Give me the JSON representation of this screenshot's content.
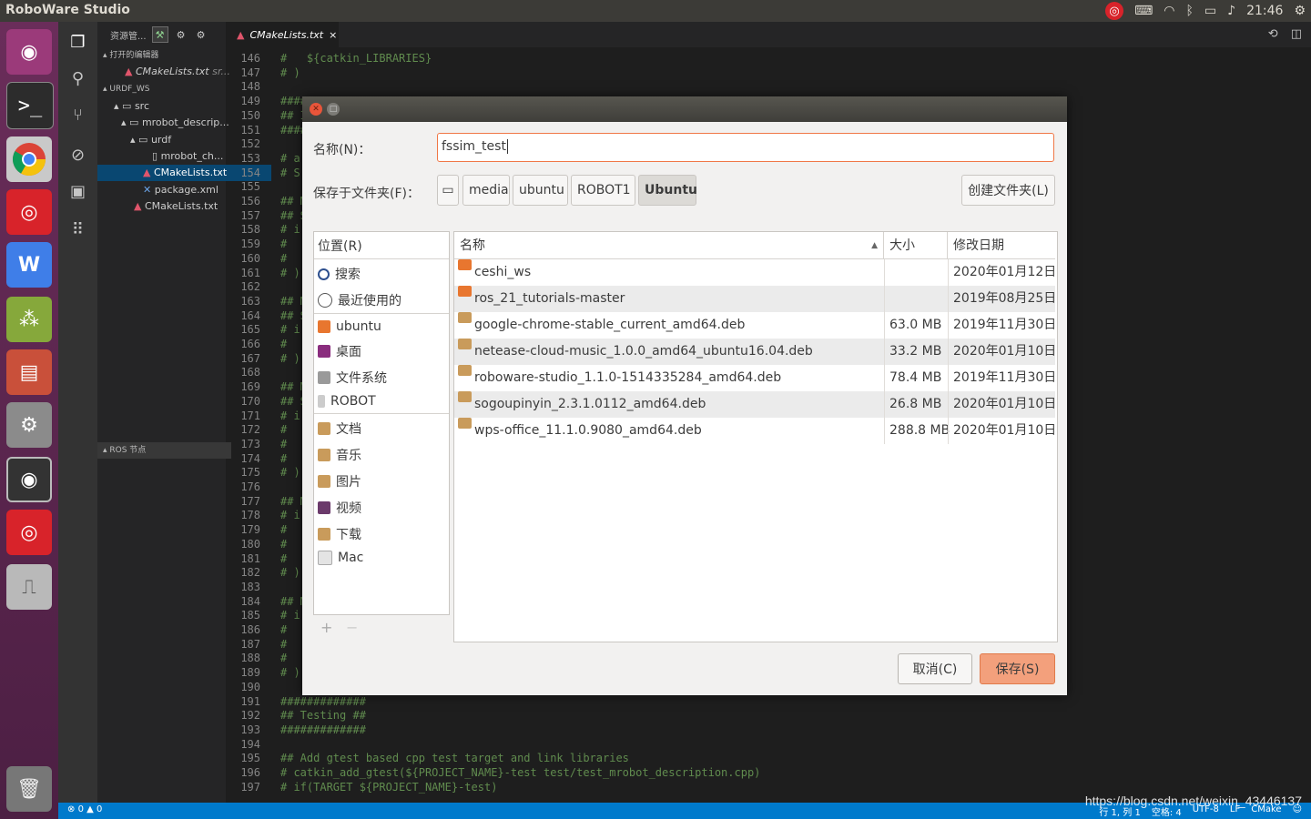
{
  "topbar": {
    "app_title": "RoboWare Studio",
    "clock": "21:46",
    "icons": [
      "netease-music-icon",
      "keyboard-icon",
      "wifi-icon",
      "bluetooth-icon",
      "battery-icon",
      "volume-icon",
      "power-gear-icon"
    ]
  },
  "launcher": {
    "items": [
      "ubuntu-dash-icon",
      "terminal-icon",
      "chrome-icon",
      "netease-music-icon",
      "wps-icon",
      "ros-icon",
      "files-icon",
      "settings-icon",
      "camera-icon",
      "netease-music-icon-2",
      "usb-icon",
      "trash-icon"
    ]
  },
  "sidebar": {
    "header": "资源管...",
    "open_editors_label": "打开的编辑器",
    "open_editor_file": "CMakeLists.txt",
    "open_editor_path": "sr...",
    "workspace_label": "URDF_WS",
    "tree": [
      {
        "label": "src"
      },
      {
        "label": "mrobot_descrip..."
      },
      {
        "label": "urdf"
      },
      {
        "label": "mrobot_ch..."
      },
      {
        "label": "CMakeLists.txt"
      },
      {
        "label": "package.xml"
      },
      {
        "label": "CMakeLists.txt"
      }
    ],
    "ros_nodes_label": "ROS 节点"
  },
  "editor": {
    "tab_label": "CMakeLists.txt",
    "lines": [
      {
        "n": "146",
        "t": "#   ${catkin_LIBRARIES}"
      },
      {
        "n": "147",
        "t": "# )"
      },
      {
        "n": "148",
        "t": ""
      },
      {
        "n": "149",
        "t": "####"
      },
      {
        "n": "150",
        "t": "## I"
      },
      {
        "n": "151",
        "t": "####"
      },
      {
        "n": "152",
        "t": ""
      },
      {
        "n": "153",
        "t": "# a"
      },
      {
        "n": "154",
        "t": "# S"
      },
      {
        "n": "155",
        "t": ""
      },
      {
        "n": "156",
        "t": "## M"
      },
      {
        "n": "157",
        "t": "## S"
      },
      {
        "n": "158",
        "t": "# i"
      },
      {
        "n": "159",
        "t": "#"
      },
      {
        "n": "160",
        "t": "#"
      },
      {
        "n": "161",
        "t": "# )"
      },
      {
        "n": "162",
        "t": ""
      },
      {
        "n": "163",
        "t": "## M"
      },
      {
        "n": "164",
        "t": "## S"
      },
      {
        "n": "165",
        "t": "# i"
      },
      {
        "n": "166",
        "t": "#"
      },
      {
        "n": "167",
        "t": "# )"
      },
      {
        "n": "168",
        "t": ""
      },
      {
        "n": "169",
        "t": "## M"
      },
      {
        "n": "170",
        "t": "## S"
      },
      {
        "n": "171",
        "t": "# i"
      },
      {
        "n": "172",
        "t": "#"
      },
      {
        "n": "173",
        "t": "#"
      },
      {
        "n": "174",
        "t": "#"
      },
      {
        "n": "175",
        "t": "# )"
      },
      {
        "n": "176",
        "t": ""
      },
      {
        "n": "177",
        "t": "## M"
      },
      {
        "n": "178",
        "t": "# i"
      },
      {
        "n": "179",
        "t": "#"
      },
      {
        "n": "180",
        "t": "#"
      },
      {
        "n": "181",
        "t": "#"
      },
      {
        "n": "182",
        "t": "# )"
      },
      {
        "n": "183",
        "t": ""
      },
      {
        "n": "184",
        "t": "## M"
      },
      {
        "n": "185",
        "t": "# i"
      },
      {
        "n": "186",
        "t": "#"
      },
      {
        "n": "187",
        "t": "#"
      },
      {
        "n": "188",
        "t": "#"
      },
      {
        "n": "189",
        "t": "# )"
      },
      {
        "n": "190",
        "t": ""
      },
      {
        "n": "191",
        "t": "#############"
      },
      {
        "n": "192",
        "t": "## Testing ##"
      },
      {
        "n": "193",
        "t": "#############"
      },
      {
        "n": "194",
        "t": ""
      },
      {
        "n": "195",
        "t": "## Add gtest based cpp test target and link libraries"
      },
      {
        "n": "196",
        "t": "# catkin_add_gtest(${PROJECT_NAME}-test test/test_mrobot_description.cpp)"
      },
      {
        "n": "197",
        "t": "# if(TARGET ${PROJECT_NAME}-test)"
      }
    ]
  },
  "status": {
    "errors": "0",
    "warnings": "0",
    "position": "行 1, 列 1",
    "spaces": "空格: 4",
    "encoding": "UTF-8",
    "eol": "LF",
    "language": "CMake"
  },
  "watermark": "https://blog.csdn.net/weixin_43446137",
  "dialog": {
    "name_label": "名称(N)：",
    "name_value": "fssim_test",
    "folder_label": "保存于文件夹(F)：",
    "path": [
      "media",
      "ubuntu",
      "ROBOT1",
      "Ubuntu"
    ],
    "create_folder": "创建文件夹(L)",
    "places_header": "位置(R)",
    "places": [
      {
        "label": "搜索",
        "icon": "search-icon"
      },
      {
        "label": "最近使用的",
        "icon": "recent-icon"
      },
      {
        "label": "ubuntu",
        "icon": "home-folder-icon"
      },
      {
        "label": "桌面",
        "icon": "desktop-icon"
      },
      {
        "label": "文件系统",
        "icon": "drive-icon"
      },
      {
        "label": "ROBOT",
        "icon": "usb-drive-icon"
      },
      {
        "label": "文档",
        "icon": "documents-icon"
      },
      {
        "label": "音乐",
        "icon": "music-icon"
      },
      {
        "label": "图片",
        "icon": "pictures-icon"
      },
      {
        "label": "视频",
        "icon": "videos-icon"
      },
      {
        "label": "下载",
        "icon": "downloads-icon"
      },
      {
        "label": "Mac",
        "icon": "file-icon"
      }
    ],
    "places_add": "+",
    "places_remove": "−",
    "columns": {
      "name": "名称",
      "size": "大小",
      "modified": "修改日期"
    },
    "files": [
      {
        "name": "ceshi_ws",
        "size": "",
        "date": "2020年01月12日",
        "type": "folder"
      },
      {
        "name": "ros_21_tutorials-master",
        "size": "",
        "date": "2019年08月25日",
        "type": "folder"
      },
      {
        "name": "google-chrome-stable_current_amd64.deb",
        "size": "63.0 MB",
        "date": "2019年11月30日",
        "type": "package"
      },
      {
        "name": "netease-cloud-music_1.0.0_amd64_ubuntu16.04.deb",
        "size": "33.2 MB",
        "date": "2020年01月10日",
        "type": "package"
      },
      {
        "name": "roboware-studio_1.1.0-1514335284_amd64.deb",
        "size": "78.4 MB",
        "date": "2019年11月30日",
        "type": "package"
      },
      {
        "name": "sogoupinyin_2.3.1.0112_amd64.deb",
        "size": "26.8 MB",
        "date": "2020年01月10日",
        "type": "package"
      },
      {
        "name": "wps-office_11.1.0.9080_amd64.deb",
        "size": "288.8 MB",
        "date": "2020年01月10日",
        "type": "package"
      }
    ],
    "cancel": "取消(C)",
    "save": "保存(S)",
    "colors": {
      "accent": "#f07746",
      "save_bg": "#f3a07c",
      "folder": "#e8762f",
      "package": "#c99b5b"
    }
  }
}
